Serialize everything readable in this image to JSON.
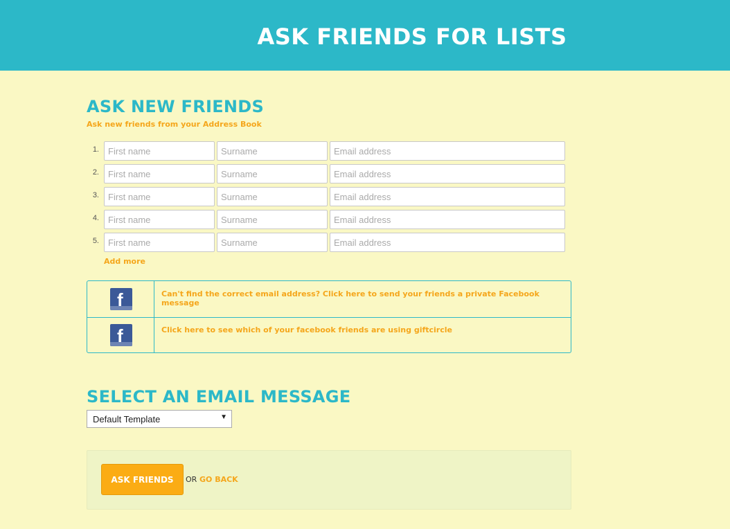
{
  "header": {
    "title": "ASK FRIENDS FOR LISTS"
  },
  "ask_section": {
    "title": "ASK NEW FRIENDS",
    "subtitle": "Ask new friends from your Address Book",
    "rows": [
      {
        "num": "1.",
        "first_placeholder": "First name",
        "surname_placeholder": "Surname",
        "email_placeholder": "Email address"
      },
      {
        "num": "2.",
        "first_placeholder": "First name",
        "surname_placeholder": "Surname",
        "email_placeholder": "Email address"
      },
      {
        "num": "3.",
        "first_placeholder": "First name",
        "surname_placeholder": "Surname",
        "email_placeholder": "Email address"
      },
      {
        "num": "4.",
        "first_placeholder": "First name",
        "surname_placeholder": "Surname",
        "email_placeholder": "Email address"
      },
      {
        "num": "5.",
        "first_placeholder": "First name",
        "surname_placeholder": "Surname",
        "email_placeholder": "Email address"
      }
    ],
    "add_more": "Add more"
  },
  "facebook": {
    "icon": "facebook-icon",
    "links": [
      "Can't find the correct email address? Click here to send your friends a private Facebook message",
      "Click here to see which of your facebook friends are using giftcircle"
    ]
  },
  "email_section": {
    "title": "SELECT AN EMAIL MESSAGE",
    "selected": "Default Template"
  },
  "actions": {
    "ask_label": "ASK FRIENDS",
    "or_text": "OR",
    "go_back": "GO BACK"
  },
  "colors": {
    "header_bg": "#2cb8c8",
    "page_bg": "#faf8c4",
    "accent_orange": "#f5a61b",
    "facebook_blue": "#3b5998"
  }
}
